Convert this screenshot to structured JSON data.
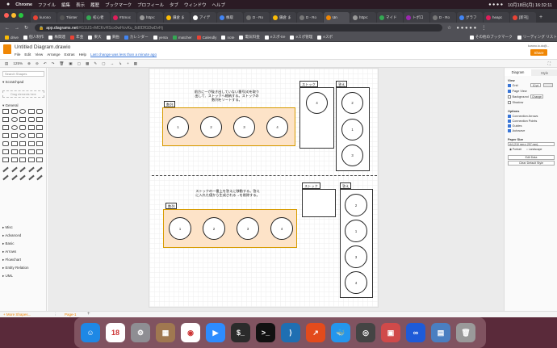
{
  "menubar": {
    "app_name": "Chrome",
    "items": [
      "ファイル",
      "編集",
      "表示",
      "履歴",
      "ブックマーク",
      "プロフィール",
      "タブ",
      "ウィンドウ",
      "ヘルプ"
    ],
    "clock": "10月18日(月) 16:32:11"
  },
  "tabs": [
    {
      "label": "kurono",
      "color": "#ea4335"
    },
    {
      "label": "Tkinter",
      "color": "#555555"
    },
    {
      "label": "初心者",
      "color": "#34a853"
    },
    {
      "label": "#Smoc",
      "color": "#e01e5a"
    },
    {
      "label": "https:",
      "color": "#999999"
    },
    {
      "label": "鎌倉 ま",
      "color": "#fbbc05"
    },
    {
      "label": "アイデ",
      "color": "#ffffff"
    },
    {
      "label": "株取",
      "color": "#4285f4"
    },
    {
      "label": "D - Ro",
      "color": "#777777"
    },
    {
      "label": "鎌倉 ま",
      "color": "#fbbc05"
    },
    {
      "label": "D - Ro",
      "color": "#777777"
    },
    {
      "label": "Un",
      "color": "#f08705"
    },
    {
      "label": "https:",
      "color": "#999999"
    },
    {
      "label": "マイド",
      "color": "#34a853"
    },
    {
      "label": "トポロ",
      "color": "#9c27b0"
    },
    {
      "label": "D - Ro",
      "color": "#777777"
    },
    {
      "label": "グラフ",
      "color": "#4285f4"
    },
    {
      "label": "heapc",
      "color": "#e01e5a"
    },
    {
      "label": "[新刊]",
      "color": "#ea4335"
    }
  ],
  "address": {
    "host": "app.diagrams.net",
    "path": "/#G1US-rMCKvHScx0wHcvKu_6d0DfGDwDvHj"
  },
  "bookmarks": [
    {
      "label": "drive",
      "color": "#fbbc05"
    },
    {
      "label": "個人制作",
      "color": "#ffffff"
    },
    {
      "label": "株関連",
      "color": "#ffffff"
    },
    {
      "label": "年金",
      "color": "#ea4335"
    },
    {
      "label": "東大",
      "color": "#ffffff"
    },
    {
      "label": "楽曲",
      "color": "#ffffff"
    },
    {
      "label": "カレンダー",
      "color": "#4285f4"
    },
    {
      "label": "yenta",
      "color": "#ffffff"
    },
    {
      "label": "matcher",
      "color": "#34a853"
    },
    {
      "label": "Calendly",
      "color": "#ea4335"
    },
    {
      "label": "note",
      "color": "#ffffff"
    },
    {
      "label": "電気料金",
      "color": "#ffffff"
    },
    {
      "label": "eスポ-tre",
      "color": "#ffffff"
    },
    {
      "label": "eスポ管理",
      "color": "#ffffff"
    },
    {
      "label": "eスポ",
      "color": "#ffffff"
    },
    {
      "label": "その他のブックマーク",
      "color": "#ffffff"
    },
    {
      "label": "リーディング リスト",
      "color": "#ffffff"
    }
  ],
  "drawio": {
    "title": "Untitled Diagram.drawio",
    "menus": [
      "File",
      "Edit",
      "View",
      "Arrange",
      "Extras",
      "Help"
    ],
    "saved_notice": "Last change was less than a minute ago",
    "share_label": "Share",
    "user_email": "kurono.io.do@...",
    "zoom": "125%",
    "search_placeholder": "Search Shapes",
    "scratchpad_label": "Scratchpad",
    "drag_hint": "Drag elements here",
    "general_label": "General",
    "sections": [
      "Misc",
      "Advanced",
      "Basic",
      "Arrows",
      "Flowchart",
      "Entity Relation",
      "UML"
    ],
    "more_shapes": "+ More Shapes...",
    "page_tab": "Page-1"
  },
  "right_panel": {
    "tab_diagram": "Diagram",
    "tab_style": "Style",
    "view_label": "View",
    "grid_label": "Grid",
    "grid_size": "10 pt",
    "page_view_label": "Page View",
    "background_label": "Background",
    "change_label": "Change",
    "shadow_label": "Shadow",
    "options_label": "Options",
    "options": [
      "Connection Arrows",
      "Connection Points",
      "Guides",
      "Autosave"
    ],
    "paper_size_label": "Paper Size",
    "paper_size_value": "A4 (210 mm x 297 mm)",
    "portrait_label": "Portrait",
    "landscape_label": "Landscape",
    "edit_data_label": "Edit Data",
    "clear_default_style_label": "Clear Default Style"
  },
  "diagram": {
    "top": {
      "description": "前方に一が抜き出していない番号(4)を取り出して、ストックへ格納する。ストックの数列をソートする。",
      "array_label": "数列",
      "array_values": [
        "1",
        "2",
        "3",
        "4"
      ],
      "stock_label": "ストック",
      "stock_values": [
        "4"
      ],
      "answer_label": "答え",
      "answer_values": [
        "2",
        "1",
        "3"
      ]
    },
    "bottom": {
      "description": "ストックの一番上を答えに移動する。答えに入れた値から生成される→を削除する。",
      "array_label": "数列",
      "array_values": [
        "1",
        "2",
        "3",
        "4"
      ],
      "stock_label": "ストック",
      "answer_label": "答え",
      "answer_values": [
        "2",
        "1",
        "3",
        "4"
      ]
    }
  },
  "dock_apps": [
    {
      "name": "Finder",
      "glyph": "☺",
      "color": "#1e88e5"
    },
    {
      "name": "Calendar",
      "glyph": "18",
      "color": "#ffffff"
    },
    {
      "name": "System Preferences",
      "glyph": "⚙",
      "color": "#8e8e93"
    },
    {
      "name": "Notes",
      "glyph": "▦",
      "color": "#a07850"
    },
    {
      "name": "Chrome",
      "glyph": "◉",
      "color": "#ffffff"
    },
    {
      "name": "Zoom",
      "glyph": "▶",
      "color": "#2d8cff"
    },
    {
      "name": "Terminal",
      "glyph": "$_",
      "color": "#2b2b2b"
    },
    {
      "name": "Terminal 2",
      "glyph": ">_",
      "color": "#111111"
    },
    {
      "name": "VS Code",
      "glyph": "⟩",
      "color": "#1f6fb2"
    },
    {
      "name": "Activity",
      "glyph": "↗",
      "color": "#e34b1c"
    },
    {
      "name": "Docker",
      "glyph": "🐳",
      "color": "#2496ed"
    },
    {
      "name": "QuickTime",
      "glyph": "◎",
      "color": "#444444"
    },
    {
      "name": "Preview",
      "glyph": "▣",
      "color": "#d04a4a"
    },
    {
      "name": "Infinity",
      "glyph": "∞",
      "color": "#1e5bd8"
    },
    {
      "name": "Downloads",
      "glyph": "▤",
      "color": "#4a7fc1"
    },
    {
      "name": "Trash",
      "glyph": "🗑",
      "color": "#9a9a9a"
    }
  ]
}
